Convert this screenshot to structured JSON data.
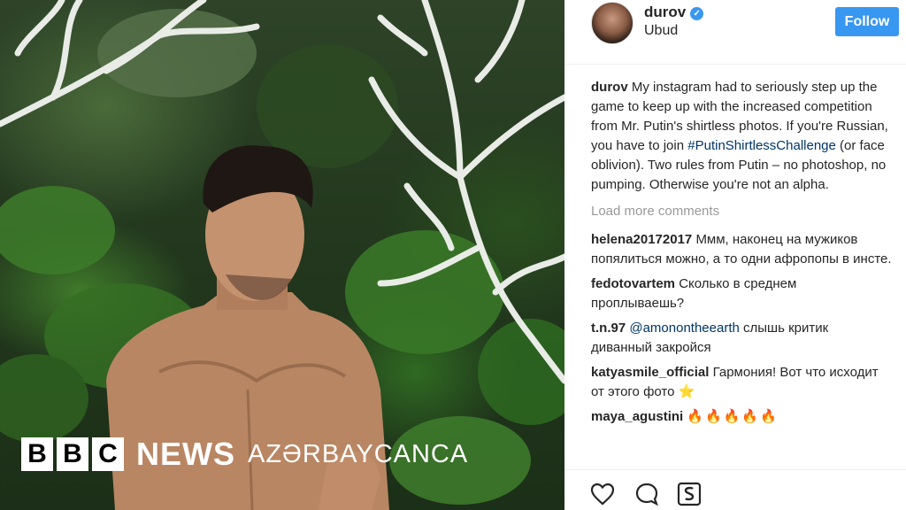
{
  "branding": {
    "letters": [
      "B",
      "B",
      "C"
    ],
    "news": "NEWS",
    "service": "AZƏRBAYCANCA"
  },
  "post": {
    "username": "durov",
    "verified": true,
    "location": "Ubud",
    "follow_label": "Follow",
    "caption": {
      "user": "durov",
      "text_before": "My instagram had to seriously step up the game to keep up with the increased competition from Mr. Putin's shirtless photos. If you're Russian, you have to join",
      "hashtag": "#PutinShirtlessChallenge",
      "text_after": "(or face oblivion). Two rules from Putin – no photoshop, no pumping. Otherwise you're not an alpha."
    },
    "load_more": "Load more comments",
    "comments": [
      {
        "user": "helena20172017",
        "text": "Ммм, наконец на мужиков попялиться можно, а то одни афропопы в инсте."
      },
      {
        "user": "fedotovartem",
        "text": "Сколько в среднем проплываешь?"
      },
      {
        "user": "t.n.97",
        "mention": "@amonontheearth",
        "text": "слышь критик диванный закройся"
      },
      {
        "user": "katyasmile_official",
        "text": "Гармония! Вот что исходит от этого фото",
        "emoji": "⭐"
      },
      {
        "user": "maya_agustini",
        "emoji": "🔥🔥🔥🔥🔥"
      }
    ]
  },
  "icons": {
    "like": "heart-icon",
    "comment": "comment-icon",
    "save": "save-icon"
  },
  "colors": {
    "follow_bg": "#3897f0",
    "hashtag": "#003569",
    "muted": "#999999"
  }
}
